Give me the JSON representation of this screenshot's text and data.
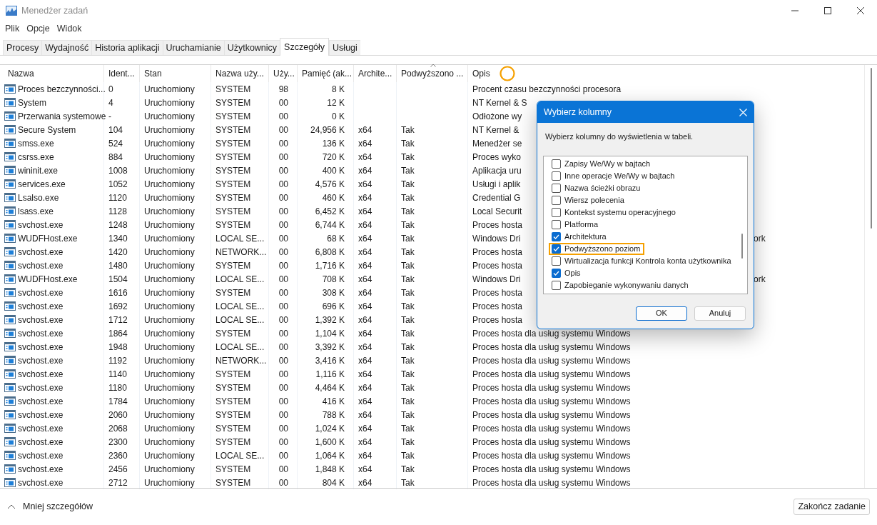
{
  "window": {
    "title": "Menedżer zadań"
  },
  "menu": [
    "Plik",
    "Opcje",
    "Widok"
  ],
  "tabs": [
    {
      "label": "Procesy",
      "selected": false
    },
    {
      "label": "Wydajność",
      "selected": false
    },
    {
      "label": "Historia aplikacji",
      "selected": false
    },
    {
      "label": "Uruchamianie",
      "selected": false
    },
    {
      "label": "Użytkownicy",
      "selected": false
    },
    {
      "label": "Szczegóły",
      "selected": true
    },
    {
      "label": "Usługi",
      "selected": false
    }
  ],
  "table": {
    "columns": [
      "Nazwa",
      "Ident...",
      "Stan",
      "Nazwa uży...",
      "Uży...",
      "Pamięć (ak...",
      "Archite...",
      "Podwyższono ...",
      "Opis"
    ],
    "rows": [
      {
        "cells": [
          "Proces bezczynności...",
          "0",
          "Uruchomiony",
          "SYSTEM",
          "98",
          "8 K",
          "",
          ""
        ],
        "desc": "Procent czasu bezczynności procesora"
      },
      {
        "cells": [
          "System",
          "4",
          "Uruchomiony",
          "SYSTEM",
          "00",
          "12 K",
          "",
          ""
        ],
        "desc": "NT Kernel & S"
      },
      {
        "cells": [
          "Przerwania systemowe",
          "-",
          "Uruchomiony",
          "SYSTEM",
          "00",
          "0 K",
          "",
          ""
        ],
        "desc": "Odłożone wy"
      },
      {
        "cells": [
          "Secure System",
          "104",
          "Uruchomiony",
          "SYSTEM",
          "00",
          "24,956 K",
          "x64",
          "Tak"
        ],
        "desc": "NT Kernel &"
      },
      {
        "cells": [
          "smss.exe",
          "524",
          "Uruchomiony",
          "SYSTEM",
          "00",
          "136 K",
          "x64",
          "Tak"
        ],
        "desc": "Menedżer se"
      },
      {
        "cells": [
          "csrss.exe",
          "884",
          "Uruchomiony",
          "SYSTEM",
          "00",
          "720 K",
          "x64",
          "Tak"
        ],
        "desc": "Proces wyko"
      },
      {
        "cells": [
          "wininit.exe",
          "1008",
          "Uruchomiony",
          "SYSTEM",
          "00",
          "400 K",
          "x64",
          "Tak"
        ],
        "desc": "Aplikacja uru"
      },
      {
        "cells": [
          "services.exe",
          "1052",
          "Uruchomiony",
          "SYSTEM",
          "00",
          "4,576 K",
          "x64",
          "Tak"
        ],
        "desc": "Usługi i aplik"
      },
      {
        "cells": [
          "Lsalso.exe",
          "1120",
          "Uruchomiony",
          "SYSTEM",
          "00",
          "460 K",
          "x64",
          "Tak"
        ],
        "desc": "Credential G"
      },
      {
        "cells": [
          "lsass.exe",
          "1128",
          "Uruchomiony",
          "SYSTEM",
          "00",
          "6,452 K",
          "x64",
          "Tak"
        ],
        "desc": "Local Securit"
      },
      {
        "cells": [
          "svchost.exe",
          "1248",
          "Uruchomiony",
          "SYSTEM",
          "00",
          "6,744 K",
          "x64",
          "Tak"
        ],
        "desc": "Proces hosta"
      },
      {
        "cells": [
          "WUDFHost.exe",
          "1340",
          "Uruchomiony",
          "LOCAL SE...",
          "00",
          "68 K",
          "x64",
          "Tak"
        ],
        "desc": "Windows Dri",
        "desc_tail": "ork"
      },
      {
        "cells": [
          "svchost.exe",
          "1420",
          "Uruchomiony",
          "NETWORK...",
          "00",
          "6,808 K",
          "x64",
          "Tak"
        ],
        "desc": "Proces hosta"
      },
      {
        "cells": [
          "svchost.exe",
          "1480",
          "Uruchomiony",
          "SYSTEM",
          "00",
          "1,716 K",
          "x64",
          "Tak"
        ],
        "desc": "Proces hosta"
      },
      {
        "cells": [
          "WUDFHost.exe",
          "1504",
          "Uruchomiony",
          "LOCAL SE...",
          "00",
          "708 K",
          "x64",
          "Tak"
        ],
        "desc": "Windows Dri",
        "desc_tail": "ork"
      },
      {
        "cells": [
          "svchost.exe",
          "1616",
          "Uruchomiony",
          "SYSTEM",
          "00",
          "308 K",
          "x64",
          "Tak"
        ],
        "desc": "Proces hosta"
      },
      {
        "cells": [
          "svchost.exe",
          "1692",
          "Uruchomiony",
          "LOCAL SE...",
          "00",
          "696 K",
          "x64",
          "Tak"
        ],
        "desc": "Proces hosta"
      },
      {
        "cells": [
          "svchost.exe",
          "1712",
          "Uruchomiony",
          "LOCAL SE...",
          "00",
          "1,392 K",
          "x64",
          "Tak"
        ],
        "desc": "Proces hosta"
      },
      {
        "cells": [
          "svchost.exe",
          "1864",
          "Uruchomiony",
          "SYSTEM",
          "00",
          "1,104 K",
          "x64",
          "Tak"
        ],
        "desc": "Proces hosta dla usług systemu Windows"
      },
      {
        "cells": [
          "svchost.exe",
          "1948",
          "Uruchomiony",
          "LOCAL SE...",
          "00",
          "3,392 K",
          "x64",
          "Tak"
        ],
        "desc": "Proces hosta dla usług systemu Windows"
      },
      {
        "cells": [
          "svchost.exe",
          "1192",
          "Uruchomiony",
          "NETWORK...",
          "00",
          "3,416 K",
          "x64",
          "Tak"
        ],
        "desc": "Proces hosta dla usług systemu Windows"
      },
      {
        "cells": [
          "svchost.exe",
          "1140",
          "Uruchomiony",
          "SYSTEM",
          "00",
          "1,116 K",
          "x64",
          "Tak"
        ],
        "desc": "Proces hosta dla usług systemu Windows"
      },
      {
        "cells": [
          "svchost.exe",
          "1180",
          "Uruchomiony",
          "SYSTEM",
          "00",
          "4,464 K",
          "x64",
          "Tak"
        ],
        "desc": "Proces hosta dla usług systemu Windows"
      },
      {
        "cells": [
          "svchost.exe",
          "1784",
          "Uruchomiony",
          "SYSTEM",
          "00",
          "416 K",
          "x64",
          "Tak"
        ],
        "desc": "Proces hosta dla usług systemu Windows"
      },
      {
        "cells": [
          "svchost.exe",
          "2060",
          "Uruchomiony",
          "SYSTEM",
          "00",
          "788 K",
          "x64",
          "Tak"
        ],
        "desc": "Proces hosta dla usług systemu Windows"
      },
      {
        "cells": [
          "svchost.exe",
          "2068",
          "Uruchomiony",
          "SYSTEM",
          "00",
          "1,024 K",
          "x64",
          "Tak"
        ],
        "desc": "Proces hosta dla usług systemu Windows"
      },
      {
        "cells": [
          "svchost.exe",
          "2300",
          "Uruchomiony",
          "SYSTEM",
          "00",
          "1,600 K",
          "x64",
          "Tak"
        ],
        "desc": "Proces hosta dla usług systemu Windows"
      },
      {
        "cells": [
          "svchost.exe",
          "2360",
          "Uruchomiony",
          "LOCAL SE...",
          "00",
          "1,064 K",
          "x64",
          "Tak"
        ],
        "desc": "Proces hosta dla usług systemu Windows"
      },
      {
        "cells": [
          "svchost.exe",
          "2456",
          "Uruchomiony",
          "SYSTEM",
          "00",
          "1,848 K",
          "x64",
          "Tak"
        ],
        "desc": "Proces hosta dla usług systemu Windows"
      },
      {
        "cells": [
          "svchost.exe",
          "2712",
          "Uruchomiony",
          "SYSTEM",
          "00",
          "804 K",
          "x64",
          "Tak"
        ],
        "desc": "Proces hosta dla usług systemu Windows"
      }
    ]
  },
  "dialog": {
    "title": "Wybierz kolumny",
    "prompt": "Wybierz kolumny do wyświetlenia w tabeli.",
    "items": [
      {
        "label": "Zapisy We/Wy w bajtach",
        "checked": false,
        "highlighted": false
      },
      {
        "label": "Inne operacje We/Wy w bajtach",
        "checked": false,
        "highlighted": false
      },
      {
        "label": "Nazwa ścieżki obrazu",
        "checked": false,
        "highlighted": false
      },
      {
        "label": "Wiersz polecenia",
        "checked": false,
        "highlighted": false
      },
      {
        "label": "Kontekst systemu operacyjnego",
        "checked": false,
        "highlighted": false
      },
      {
        "label": "Platforma",
        "checked": false,
        "highlighted": false
      },
      {
        "label": "Architektura",
        "checked": true,
        "highlighted": false
      },
      {
        "label": "Podwyższono poziom",
        "checked": true,
        "highlighted": true
      },
      {
        "label": "Wirtualizacja funkcji Kontrola konta użytkownika",
        "checked": false,
        "highlighted": false
      },
      {
        "label": "Opis",
        "checked": true,
        "highlighted": false
      },
      {
        "label": "Zapobieganie wykonywaniu danych",
        "checked": false,
        "highlighted": false
      }
    ],
    "buttons": [
      "OK",
      "Anuluj"
    ]
  },
  "footer": {
    "toggle": "Mniej szczegółów",
    "end_task": "Zakończ zadanie"
  }
}
